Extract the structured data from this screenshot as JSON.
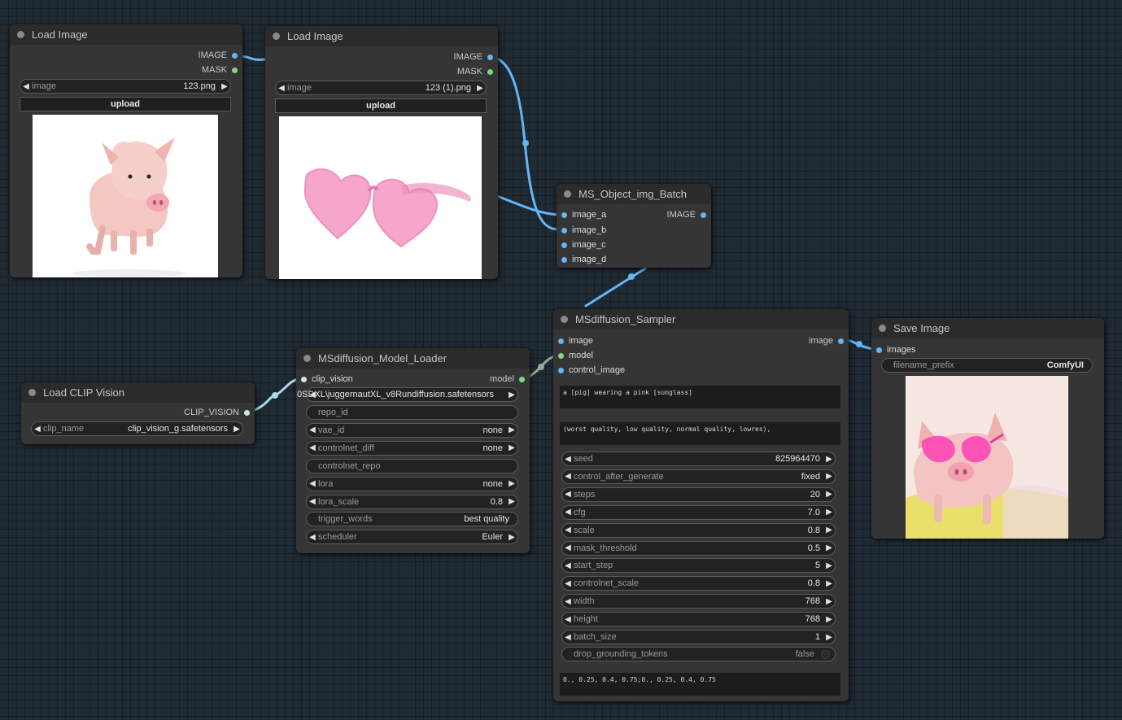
{
  "colors": {
    "background": "#202a33",
    "node": "#353535",
    "title_bar": "#2b2b2b",
    "image_link": "#64b5f6",
    "model_link": "#7ed97e",
    "clip_link": "#a8d8ea"
  },
  "load_image_1": {
    "title": "Load Image",
    "outputs": [
      "IMAGE",
      "MASK"
    ],
    "image_widget": {
      "label": "image",
      "value": "123.png"
    },
    "upload_label": "upload",
    "preview": "pink-piglet-icon"
  },
  "load_image_2": {
    "title": "Load Image",
    "outputs": [
      "IMAGE",
      "MASK"
    ],
    "image_widget": {
      "label": "image",
      "value": "123 (1).png"
    },
    "upload_label": "upload",
    "preview": "pink-heart-sunglasses-icon"
  },
  "batch_node": {
    "title": "MS_Object_img_Batch",
    "inputs": [
      "image_a",
      "image_b",
      "image_c",
      "image_d"
    ],
    "output": "IMAGE"
  },
  "clip_vision": {
    "title": "Load CLIP Vision",
    "output": "CLIP_VISION",
    "clip_name": {
      "label": "clip_name",
      "value": "clip_vision_g.safetensors"
    }
  },
  "model_loader": {
    "title": "MSdiffusion_Model_Loader",
    "input": "clip_vision",
    "output": "model",
    "overlap_text": "0SDXL\\juggernautXL_v8Rundiffusion.safetensors",
    "widgets": [
      {
        "label": "repo_id",
        "value": "",
        "kind": "text"
      },
      {
        "label": "vae_id",
        "value": "none",
        "kind": "combo"
      },
      {
        "label": "controlnet_diff",
        "value": "none",
        "kind": "combo"
      },
      {
        "label": "controlnet_repo",
        "value": "",
        "kind": "text"
      },
      {
        "label": "lora",
        "value": "none",
        "kind": "combo"
      },
      {
        "label": "lora_scale",
        "value": "0.8",
        "kind": "combo"
      },
      {
        "label": "trigger_words",
        "value": "best quality",
        "kind": "text"
      },
      {
        "label": "scheduler",
        "value": "Euler",
        "kind": "combo"
      }
    ]
  },
  "sampler": {
    "title": "MSdiffusion_Sampler",
    "inputs": [
      "image",
      "model",
      "control_image"
    ],
    "output": "image",
    "prompt": "a [pig] wearing a pink [sunglass]",
    "negative": "(worst quality, low quality, normal quality, lowres),",
    "widgets": [
      {
        "label": "seed",
        "value": "825964470"
      },
      {
        "label": "control_after_generate",
        "value": "fixed"
      },
      {
        "label": "steps",
        "value": "20"
      },
      {
        "label": "cfg",
        "value": "7.0"
      },
      {
        "label": "scale",
        "value": "0.8"
      },
      {
        "label": "mask_threshold",
        "value": "0.5"
      },
      {
        "label": "start_step",
        "value": "5"
      },
      {
        "label": "controlnet_scale",
        "value": "0.8"
      },
      {
        "label": "width",
        "value": "768"
      },
      {
        "label": "height",
        "value": "768"
      },
      {
        "label": "batch_size",
        "value": "1"
      }
    ],
    "toggle": {
      "label": "drop_grounding_tokens",
      "value": "false"
    },
    "boxes_text": "0., 0.25, 0.4, 0.75;0., 0.25, 0.4, 0.75"
  },
  "save_image": {
    "title": "Save Image",
    "input": "images",
    "filename_prefix": {
      "label": "filename_prefix",
      "value": "ComfyUI"
    },
    "preview": "pig-wearing-pink-sunglasses-icon"
  }
}
